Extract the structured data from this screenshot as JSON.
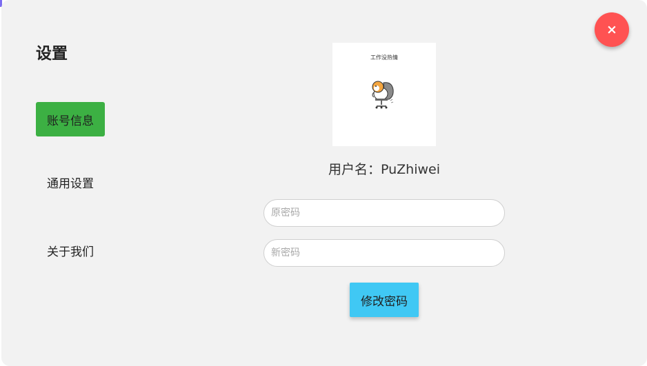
{
  "dialog": {
    "title": "设置",
    "close_label": "×"
  },
  "sidebar": {
    "items": [
      {
        "label": "账号信息",
        "active": true
      },
      {
        "label": "通用设置",
        "active": false
      },
      {
        "label": "关于我们",
        "active": false
      }
    ]
  },
  "profile": {
    "avatar_caption": "工作没热情",
    "username_label": "用户名：",
    "username": "PuZhiwei",
    "username_display": "用户名：PuZhiwei"
  },
  "form": {
    "old_password_placeholder": "原密码",
    "new_password_placeholder": "新密码",
    "submit_label": "修改密码"
  },
  "colors": {
    "active_nav": "#3cb043",
    "close_button": "#ff5252",
    "submit_button": "#40c8f4",
    "dialog_bg": "#f2f2f2"
  },
  "icons": {
    "close": "close-icon",
    "avatar": "sticker-avatar-image"
  }
}
